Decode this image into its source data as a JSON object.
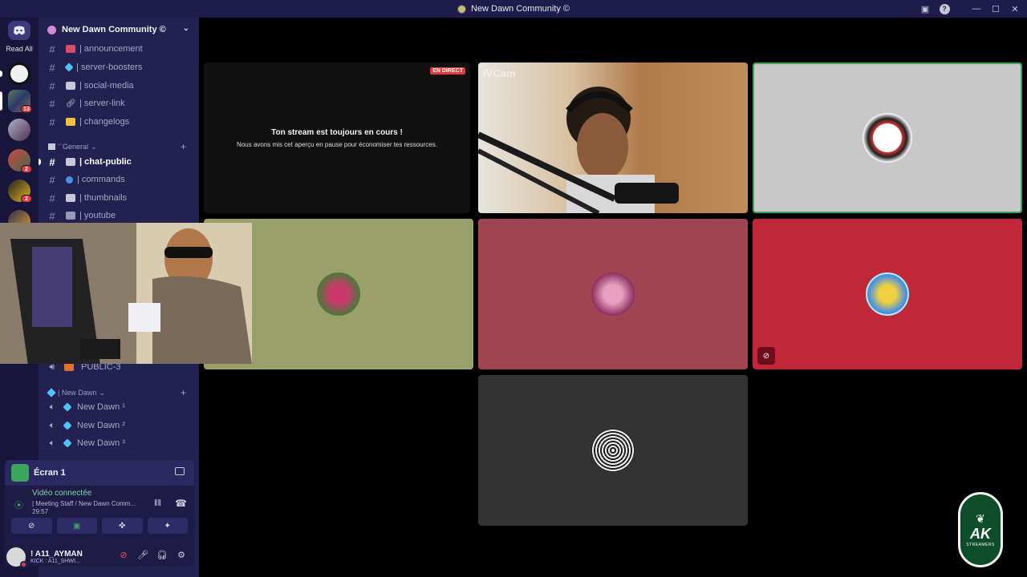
{
  "window": {
    "title": "New Dawn Community ©"
  },
  "guild_bar": {
    "read_all": "Read All",
    "badges": [
      "13",
      "2",
      "2"
    ]
  },
  "server": {
    "name": "New Dawn Community ©"
  },
  "channels": {
    "text_top": [
      {
        "label": "| announcement"
      },
      {
        "label": "| server-boosters"
      },
      {
        "label": "| social-media"
      },
      {
        "label": "| server-link"
      },
      {
        "label": "| changelogs"
      }
    ],
    "category_general": "¨¨General",
    "general": [
      {
        "label": "| chat-public"
      },
      {
        "label": "| commands"
      },
      {
        "label": "| thumbnails"
      },
      {
        "label": "| youtube"
      }
    ],
    "voice_public": "PUBLIC-3",
    "category_newdawn": "| New Dawn",
    "newdawn": [
      {
        "label": "New Dawn ¹"
      },
      {
        "label": "New Dawn ²"
      },
      {
        "label": "New Dawn ³"
      }
    ]
  },
  "stream_panel": {
    "title": "Écran 1",
    "status": "Vidéo connectée",
    "subtitle": "| Meeting Staff / New Dawn Comm...",
    "elapsed": "29:57"
  },
  "user": {
    "name": "! A11_AYMAN",
    "status_text": "KICK : A11_SHWI..."
  },
  "tiles": {
    "live_badge": "EN DIRECT",
    "paused_title": "Ton stream est toujours en cours !",
    "paused_sub": "Nous avons mis cet aperçu en pause pour économiser tes ressources.",
    "cam_label": "iVCam"
  },
  "logo": {
    "text": "AK",
    "sub": "STREAMERS"
  },
  "colors": {
    "tile_grey": "#c8c8c8",
    "tile_olive": "#9aa06a",
    "tile_rose": "#a04452",
    "tile_red": "#c0283a",
    "tile_dark": "#333333",
    "speaking_outline": "#3ba55c"
  }
}
